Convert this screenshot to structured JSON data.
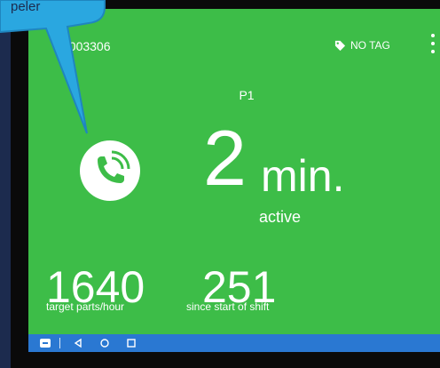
{
  "header": {
    "machine_id": "0003306",
    "tag_label": "NO TAG"
  },
  "status": {
    "station": "P1",
    "duration_value": "2",
    "duration_unit": "min.",
    "state": "active"
  },
  "stats": [
    {
      "value": "1640",
      "label": "target parts/hour"
    },
    {
      "value": "251",
      "label": "since start of shift"
    }
  ],
  "callout": {
    "text": "peler"
  },
  "colors": {
    "screen_background": "#3dbd48",
    "navbar": "#2a78d2",
    "callout": "#2aa7e0"
  },
  "icons": {
    "call": "phone-call-icon",
    "tag": "tag-icon",
    "menu": "more-vertical-icon",
    "nav": [
      "app-switch-icon",
      "back-icon",
      "home-icon",
      "recents-icon"
    ]
  }
}
